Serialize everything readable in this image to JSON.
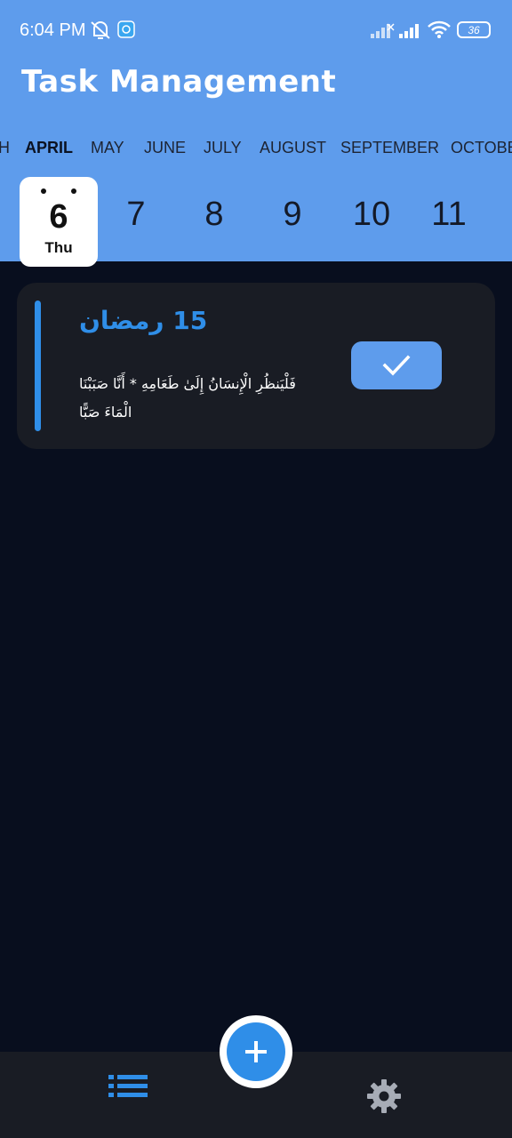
{
  "status_bar": {
    "time": "6:04 PM",
    "battery": "36",
    "icons": [
      "mute-icon",
      "app-notification-icon",
      "signal-icon",
      "signal-icon",
      "wifi-icon",
      "battery-icon"
    ]
  },
  "app": {
    "title": "Task Management"
  },
  "months": {
    "items": [
      "H",
      "APRIL",
      "MAY",
      "JUNE",
      "JULY",
      "AUGUST",
      "SEPTEMBER",
      "OCTOBE"
    ],
    "selected": "APRIL"
  },
  "dates": {
    "selected": {
      "day": "6",
      "weekday": "Thu"
    },
    "items": [
      "7",
      "8",
      "9",
      "10",
      "11"
    ]
  },
  "task": {
    "title": "15 رمضان",
    "body": "فَلْيَنظُرِ الْإِنسَانُ إِلَىٰ طَعَامِهِ * أَنَّا صَبَبْنَا الْمَاءَ صَبًّا",
    "accent_color": "#2f8ee8",
    "done_icon": "check-icon"
  },
  "bottom_nav": {
    "items": [
      "list-icon",
      "settings-icon"
    ],
    "fab_icon": "plus-icon"
  },
  "colors": {
    "header": "#5e9cec",
    "background": "#080e1e",
    "card": "#191c24",
    "accent": "#2f8ee8"
  }
}
